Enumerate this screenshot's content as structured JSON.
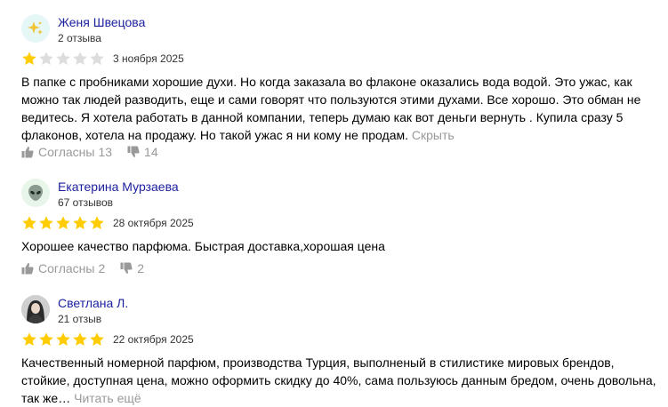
{
  "reviews": [
    {
      "avatar_icon": "sparkle-icon",
      "author": "Женя Швецова",
      "reviews_count": "2 отзыва",
      "rating": 1,
      "max_rating": 5,
      "date": "3 ноября 2025",
      "text": "В папке с пробниками хорошие духи. Но когда заказала во флаконе оказались вода водой. Это ужас, как можно так людей разводить, еще и сами говорят что пользуются этими духами. Все хорошо. Это обман не ведитесь. Я хотела работать в данной компании, теперь думаю как вот деньги вернуть . Купила сразу 5 флаконов, хотела на продажу. Но такой ужас я ни кому не продам.",
      "more_label": "Скрыть",
      "agree_label": "Согласны",
      "agree_count": "13",
      "disagree_count": "14"
    },
    {
      "avatar_icon": "alien-icon",
      "author": "Екатерина Мурзаева",
      "reviews_count": "67 отзывов",
      "rating": 5,
      "max_rating": 5,
      "date": "28 октября 2025",
      "text": "Хорошее качество парфюма. Быстрая доставка,хорошая цена",
      "agree_label": "Согласны",
      "agree_count": "2",
      "disagree_count": "2"
    },
    {
      "avatar_icon": "user-photo",
      "author": "Светлана Л.",
      "reviews_count": "21 отзыв",
      "rating": 5,
      "max_rating": 5,
      "date": "22 октября 2025",
      "text": "Качественный номерной парфюм, производства Турция, выполненый в стилистике мировых брендов, стойкие, доступная цена, можно оформить скидку до 40%, сама пользуюсь данным бредом, очень довольна, так же…",
      "more_label": "Читать ещё"
    }
  ],
  "colors": {
    "star_filled": "#fc0",
    "star_empty": "#ddd",
    "author_link": "#1a1f9e",
    "muted": "#999"
  }
}
